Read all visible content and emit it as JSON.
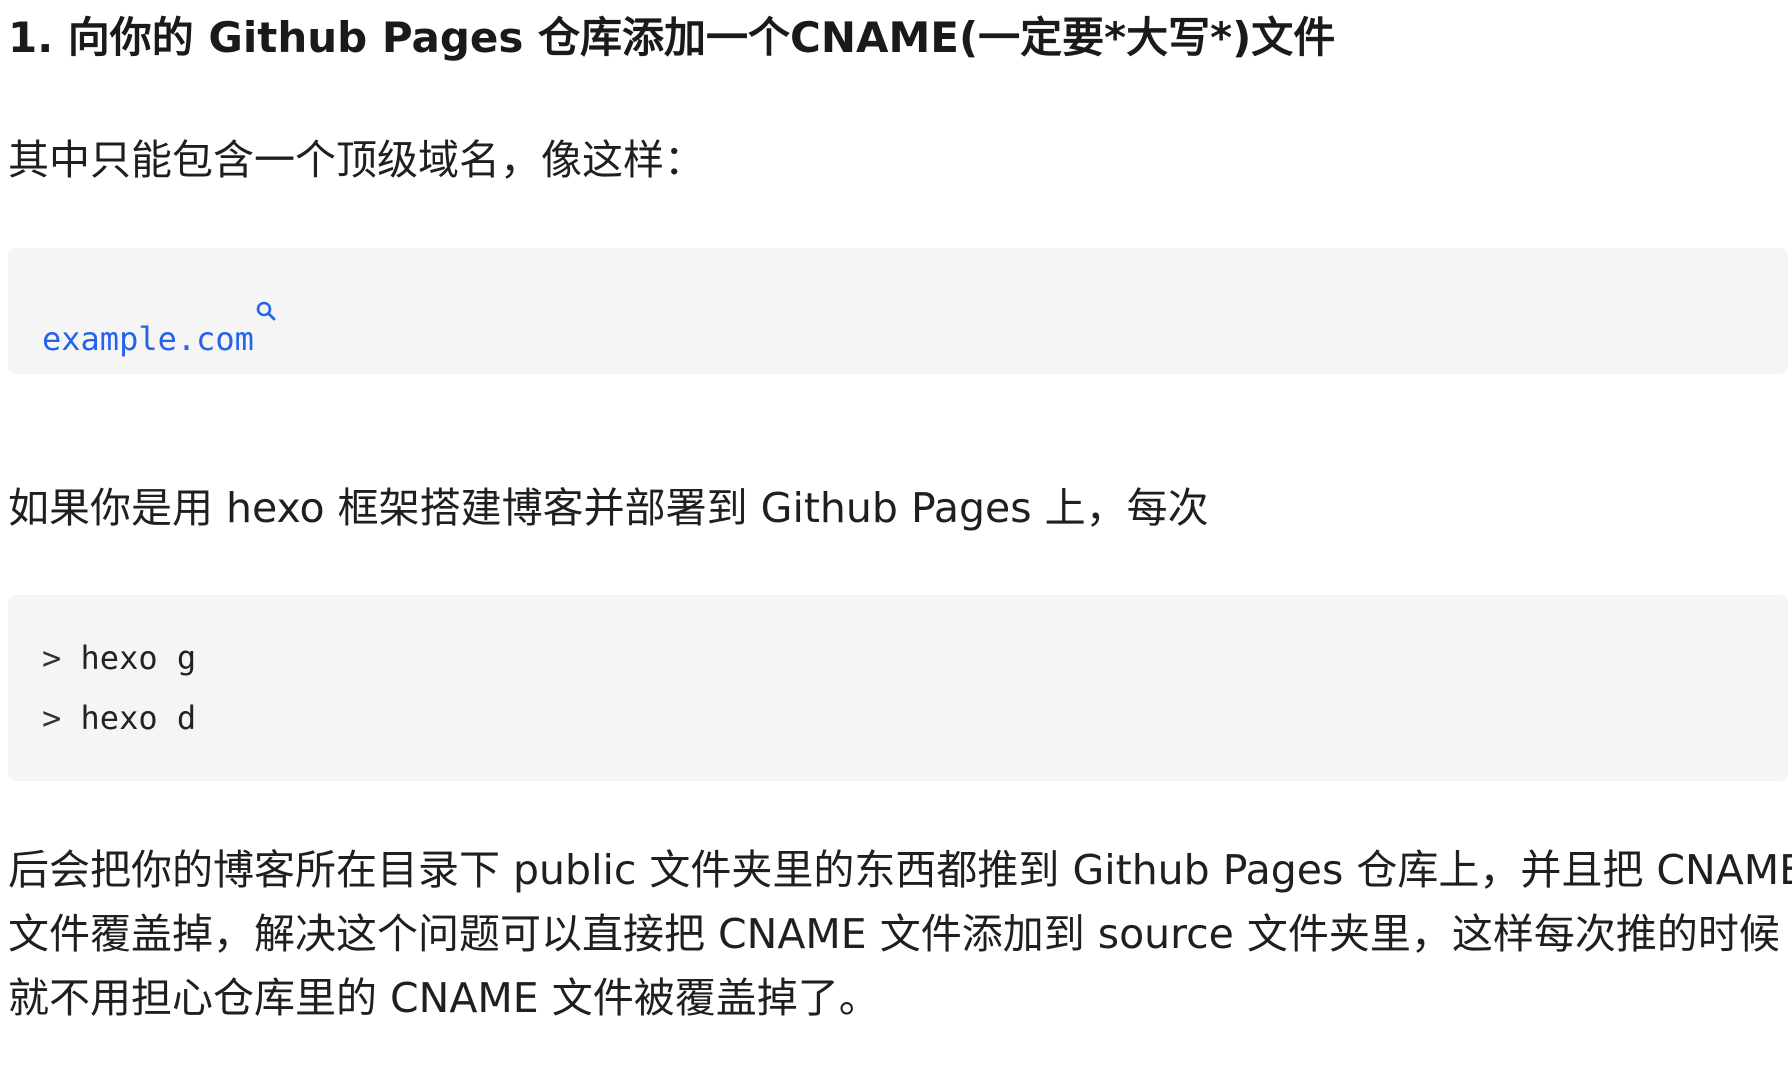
{
  "heading": "1. 向你的 Github Pages 仓库添加一个CNAME(一定要*大写*)文件",
  "para_intro": "其中只能包含一个顶级域名，像这样：",
  "code_block_1": {
    "link_text": "example.com",
    "icon": "search-icon",
    "link_color": "#2563eb"
  },
  "para_deploy": "如果你是用 hexo 框架搭建博客并部署到 Github Pages 上，每次",
  "code_block_2": {
    "lines": [
      {
        "prompt": ">",
        "command": "hexo g"
      },
      {
        "prompt": ">",
        "command": "hexo d"
      }
    ]
  },
  "para_explain": {
    "lines": [
      "后会把你的博客所在目录下 public 文件夹里的东西都推到 Github Pages 仓库上，并且把 CNAME",
      "文件覆盖掉，解决这个问题可以直接把 CNAME 文件添加到 source 文件夹里，这样每次推的时候",
      "就不用担心仓库里的 CNAME 文件被覆盖掉了。"
    ]
  }
}
